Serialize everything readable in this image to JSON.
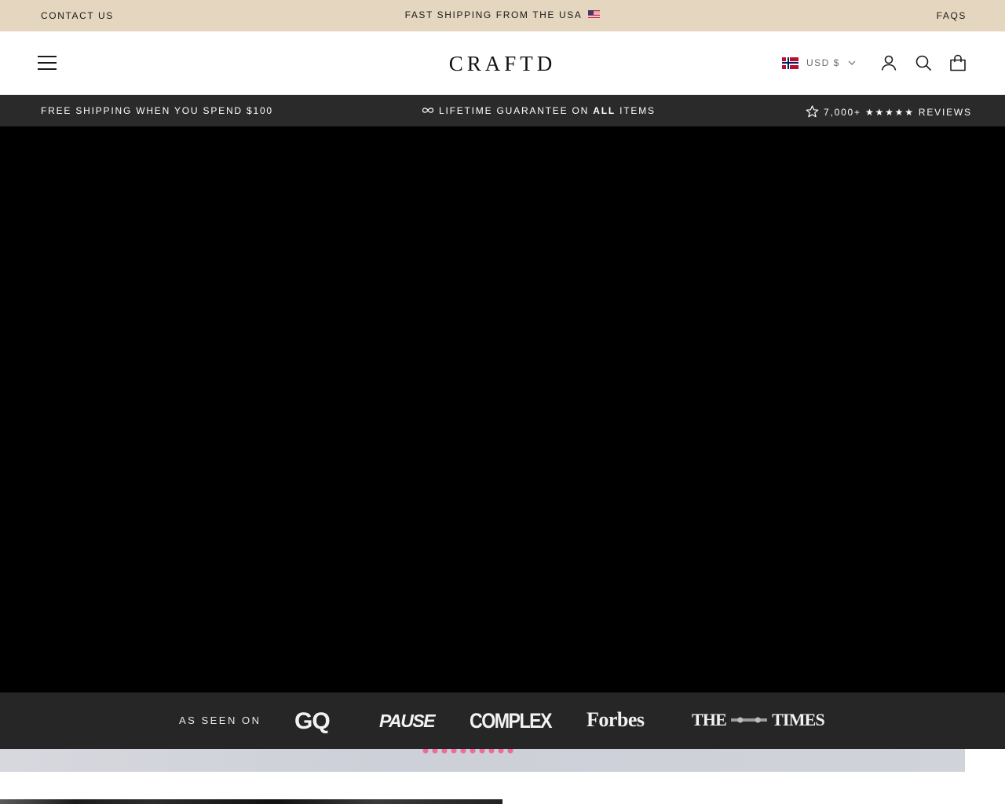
{
  "announcement": {
    "contact_label": "CONTACT US",
    "shipping_text": "FAST SHIPPING FROM THE USA",
    "faqs_label": "FAQS"
  },
  "header": {
    "logo_text": "CRAFTD",
    "currency_label": "USD $",
    "icons": [
      "menu-icon",
      "account-icon",
      "search-icon",
      "cart-icon"
    ]
  },
  "usp_bar": {
    "free_shipping": "FREE SHIPPING WHEN YOU SPEND $100",
    "guarantee_prefix": "LIFETIME GUARANTEE ON",
    "guarantee_bold": "ALL",
    "guarantee_suffix": "ITEMS",
    "reviews": "7,000+ ★★★★★ REVIEWS"
  },
  "press": {
    "label": "AS SEEN ON",
    "logos": [
      "GQ",
      "PAUSE",
      "COMPLEX",
      "Forbes",
      "THE",
      "TIMES"
    ]
  },
  "colors": {
    "announcement_bg": "#e4d6bf",
    "usp_bg": "#2a2a2a",
    "hero_bg": "#000000",
    "press_bg": "#262626"
  }
}
